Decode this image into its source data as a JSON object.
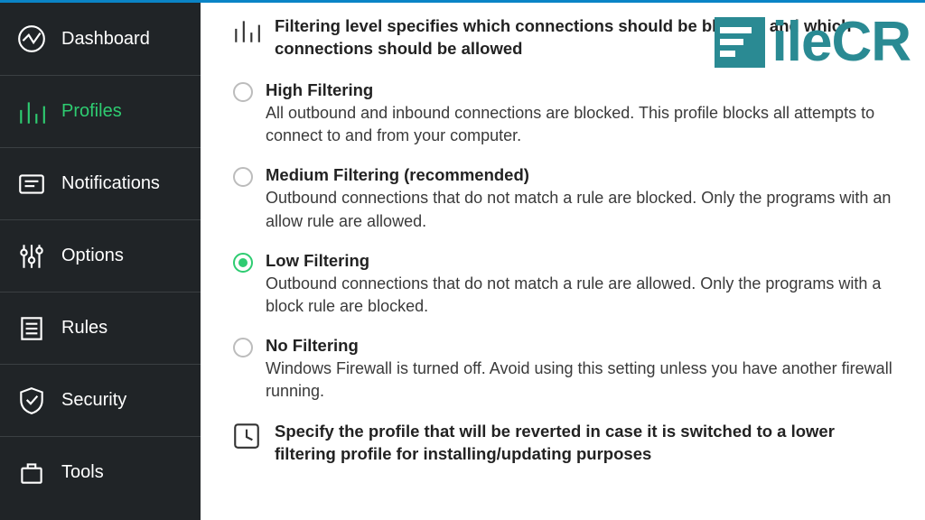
{
  "sidebar": {
    "items": [
      {
        "label": "Dashboard"
      },
      {
        "label": "Profiles"
      },
      {
        "label": "Notifications"
      },
      {
        "label": "Options"
      },
      {
        "label": "Rules"
      },
      {
        "label": "Security"
      },
      {
        "label": "Tools"
      }
    ],
    "active_index": 1
  },
  "header_intro": "Filtering level specifies which connections should be blocked and which connections should be allowed",
  "options": [
    {
      "title": "High Filtering",
      "desc": "All outbound and inbound connections are blocked. This profile blocks all attempts to connect to and from your computer."
    },
    {
      "title": "Medium Filtering (recommended)",
      "desc": "Outbound connections that do not match a rule are blocked. Only the programs with an allow rule are allowed."
    },
    {
      "title": "Low Filtering",
      "desc": "Outbound connections that do not match a rule are allowed. Only the programs with a block rule are blocked."
    },
    {
      "title": "No Filtering",
      "desc": "Windows Firewall is turned off. Avoid using this setting unless you have another firewall running."
    }
  ],
  "selected_option_index": 2,
  "revert_header": "Specify the profile that will be reverted in case it is switched to a lower filtering profile for installing/updating purposes",
  "watermark_text": "ileCR"
}
